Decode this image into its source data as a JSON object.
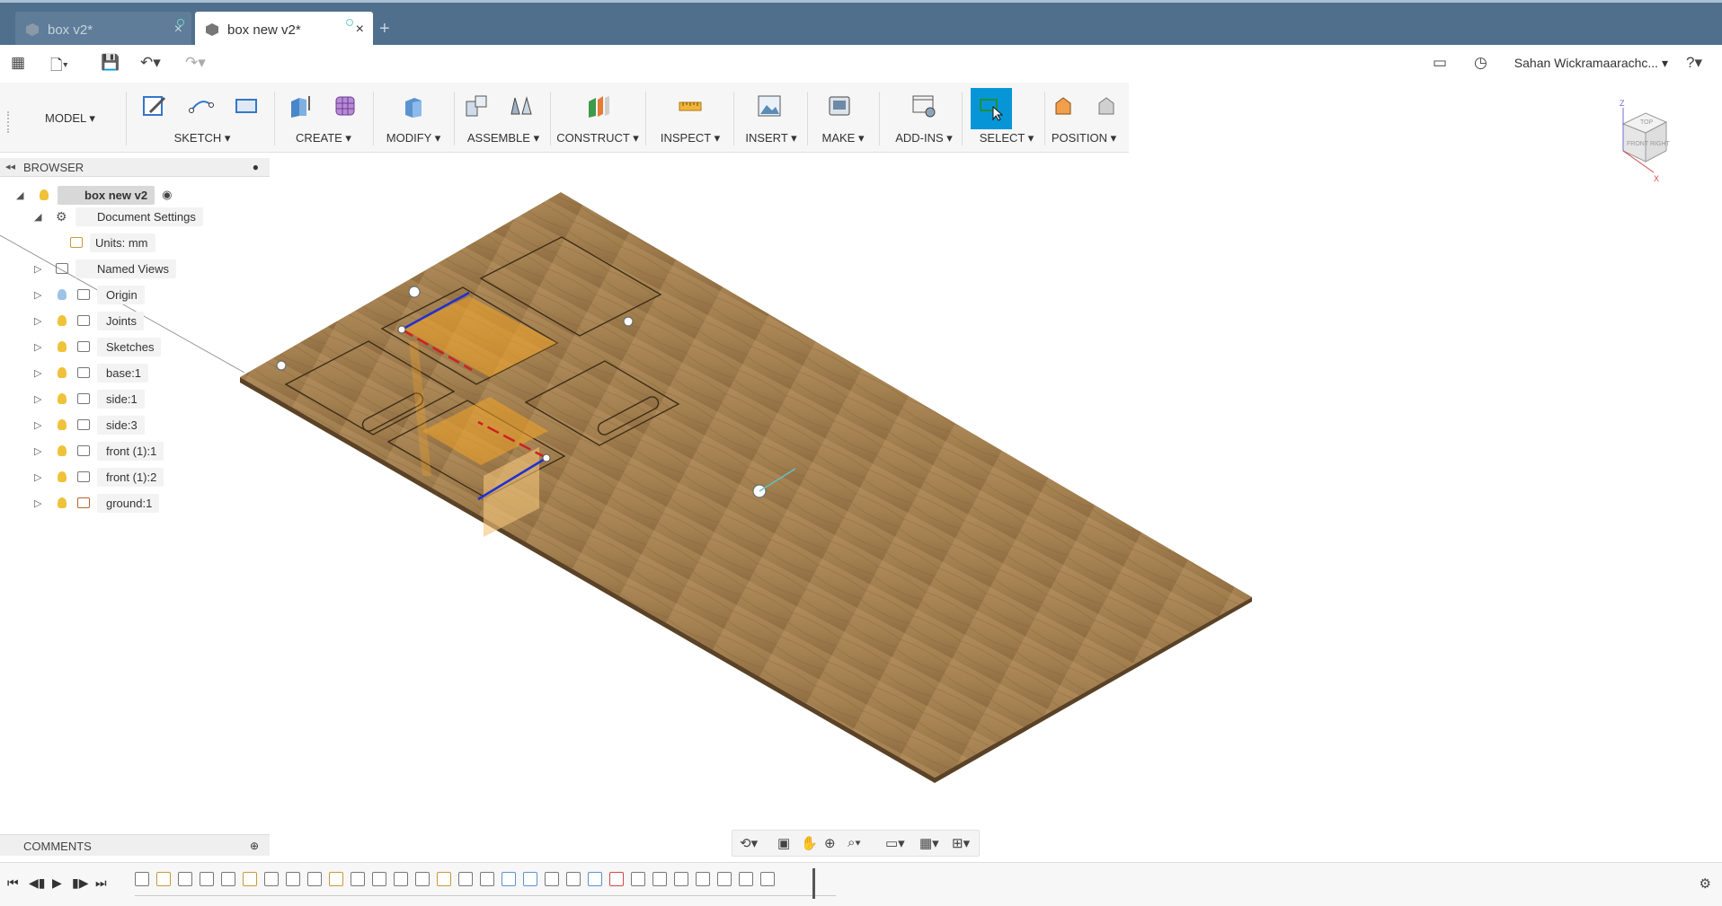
{
  "tabs": [
    {
      "label": "box v2*",
      "active": false
    },
    {
      "label": "box new v2*",
      "active": true
    }
  ],
  "new_tab_glyph": "+",
  "quick_access": {
    "user_name": "Sahan Wickramaarachc...",
    "icons": [
      "apps-grid-icon",
      "file-icon",
      "save-icon",
      "undo-icon",
      "redo-icon",
      "notifications-icon",
      "history-icon",
      "help-icon"
    ]
  },
  "ribbon": {
    "mode": "MODEL ▾",
    "groups": [
      {
        "label": "SKETCH ▾",
        "icons": [
          "create-sketch-icon",
          "line-icon",
          "rectangle-icon"
        ]
      },
      {
        "label": "CREATE ▾",
        "icons": [
          "extrude-icon",
          "form-icon"
        ]
      },
      {
        "label": "MODIFY ▾",
        "icons": [
          "press-pull-icon"
        ]
      },
      {
        "label": "ASSEMBLE ▾",
        "icons": [
          "new-component-icon",
          "joint-icon"
        ]
      },
      {
        "label": "CONSTRUCT ▾",
        "icons": [
          "offset-plane-icon"
        ]
      },
      {
        "label": "INSPECT ▾",
        "icons": [
          "measure-icon"
        ]
      },
      {
        "label": "INSERT ▾",
        "icons": [
          "insert-image-icon"
        ]
      },
      {
        "label": "MAKE ▾",
        "icons": [
          "3d-print-icon"
        ]
      },
      {
        "label": "ADD-INS ▾",
        "icons": [
          "scripts-icon"
        ]
      },
      {
        "label": "SELECT ▾",
        "icons": [
          "select-icon"
        ]
      },
      {
        "label": "POSITION ▾",
        "icons": [
          "capture-position-icon",
          "revert-position-icon"
        ]
      }
    ]
  },
  "browser": {
    "title": "BROWSER",
    "items": [
      {
        "label": "box new v2",
        "expanded": true,
        "type": "root"
      },
      {
        "label": "Document Settings",
        "expanded": true,
        "type": "settings"
      },
      {
        "label": "Units: mm",
        "type": "units"
      },
      {
        "label": "Named Views",
        "type": "folder"
      },
      {
        "label": "Origin",
        "type": "folder"
      },
      {
        "label": "Joints",
        "type": "folder"
      },
      {
        "label": "Sketches",
        "type": "folder"
      },
      {
        "label": "base:1",
        "type": "component"
      },
      {
        "label": "side:1",
        "type": "component"
      },
      {
        "label": "side:3",
        "type": "component"
      },
      {
        "label": "front (1):1",
        "type": "component"
      },
      {
        "label": "front (1):2",
        "type": "component"
      },
      {
        "label": "ground:1",
        "type": "component"
      }
    ]
  },
  "viewcube": {
    "top": "TOP",
    "front": "FRONT",
    "right": "RIGHT",
    "axis_z": "Z",
    "axis_x": "X"
  },
  "comments": {
    "title": "COMMENTS"
  },
  "colors": {
    "tabbar": "#4f6f8d",
    "select_active": "#0696d7",
    "wood": "#a67f4f",
    "highlight_orange": "#f4a62a"
  }
}
